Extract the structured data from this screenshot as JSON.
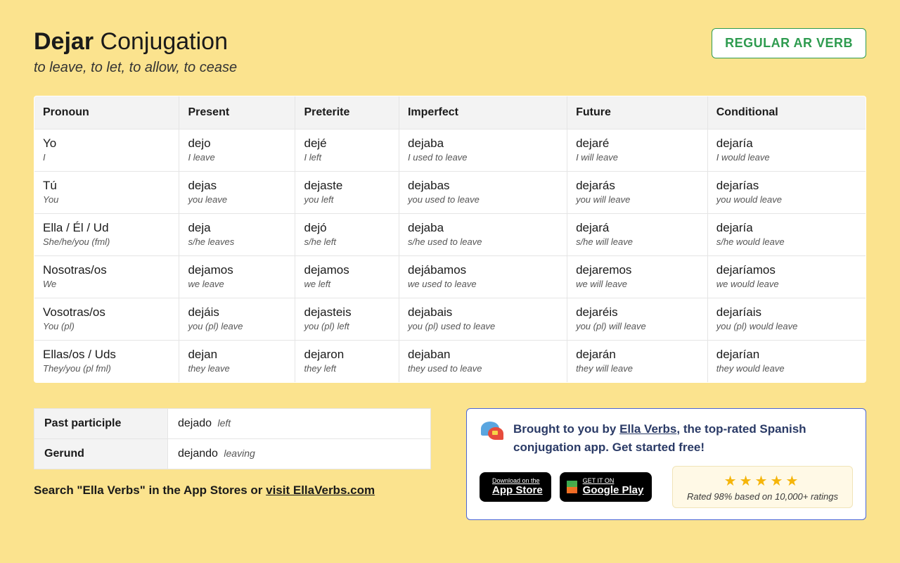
{
  "title": {
    "verb": "Dejar",
    "suffix": "Conjugation"
  },
  "definition": "to leave, to let, to allow, to cease",
  "badge": "REGULAR AR VERB",
  "headers": [
    "Pronoun",
    "Present",
    "Preterite",
    "Imperfect",
    "Future",
    "Conditional"
  ],
  "rows": [
    {
      "pronoun": {
        "main": "Yo",
        "sub": "I"
      },
      "cells": [
        {
          "main": "dejo",
          "sub": "I leave"
        },
        {
          "main": "dejé",
          "sub": "I left"
        },
        {
          "main": "dejaba",
          "sub": "I used to leave"
        },
        {
          "main": "dejaré",
          "sub": "I will leave"
        },
        {
          "main": "dejaría",
          "sub": "I would leave"
        }
      ]
    },
    {
      "pronoun": {
        "main": "Tú",
        "sub": "You"
      },
      "cells": [
        {
          "main": "dejas",
          "sub": "you leave"
        },
        {
          "main": "dejaste",
          "sub": "you left"
        },
        {
          "main": "dejabas",
          "sub": "you used to leave"
        },
        {
          "main": "dejarás",
          "sub": "you will leave"
        },
        {
          "main": "dejarías",
          "sub": "you would leave"
        }
      ]
    },
    {
      "pronoun": {
        "main": "Ella / Él / Ud",
        "sub": "She/he/you (fml)"
      },
      "cells": [
        {
          "main": "deja",
          "sub": "s/he leaves"
        },
        {
          "main": "dejó",
          "sub": "s/he left"
        },
        {
          "main": "dejaba",
          "sub": "s/he used to leave"
        },
        {
          "main": "dejará",
          "sub": "s/he will leave"
        },
        {
          "main": "dejaría",
          "sub": "s/he would leave"
        }
      ]
    },
    {
      "pronoun": {
        "main": "Nosotras/os",
        "sub": "We"
      },
      "cells": [
        {
          "main": "dejamos",
          "sub": "we leave"
        },
        {
          "main": "dejamos",
          "sub": "we left"
        },
        {
          "main": "dejábamos",
          "sub": "we used to leave"
        },
        {
          "main": "dejaremos",
          "sub": "we will leave"
        },
        {
          "main": "dejaríamos",
          "sub": "we would leave"
        }
      ]
    },
    {
      "pronoun": {
        "main": "Vosotras/os",
        "sub": "You (pl)"
      },
      "cells": [
        {
          "main": "dejáis",
          "sub": "you (pl) leave"
        },
        {
          "main": "dejasteis",
          "sub": "you (pl) left"
        },
        {
          "main": "dejabais",
          "sub": "you (pl) used to leave"
        },
        {
          "main": "dejaréis",
          "sub": "you (pl) will leave"
        },
        {
          "main": "dejaríais",
          "sub": "you (pl) would leave"
        }
      ]
    },
    {
      "pronoun": {
        "main": "Ellas/os / Uds",
        "sub": "They/you (pl fml)"
      },
      "cells": [
        {
          "main": "dejan",
          "sub": "they leave"
        },
        {
          "main": "dejaron",
          "sub": "they left"
        },
        {
          "main": "dejaban",
          "sub": "they used to leave"
        },
        {
          "main": "dejarán",
          "sub": "they will leave"
        },
        {
          "main": "dejarían",
          "sub": "they would leave"
        }
      ]
    }
  ],
  "forms": {
    "past_participle": {
      "label": "Past participle",
      "main": "dejado",
      "sub": "left"
    },
    "gerund": {
      "label": "Gerund",
      "main": "dejando",
      "sub": "leaving"
    }
  },
  "search_line": {
    "prefix": "Search \"Ella Verbs\"",
    "middle": " in the App Stores or ",
    "link": "visit EllaVerbs.com"
  },
  "promo": {
    "text_prefix": "Brought to you by ",
    "link": "Ella Verbs",
    "text_suffix": ", the top-rated Spanish conjugation app. Get started free!",
    "appstore": {
      "small": "Download on the",
      "big": "App Store"
    },
    "gplay": {
      "small": "GET IT ON",
      "big": "Google Play"
    },
    "stars": "★★★★★",
    "rating_text": "Rated 98% based on 10,000+ ratings"
  }
}
